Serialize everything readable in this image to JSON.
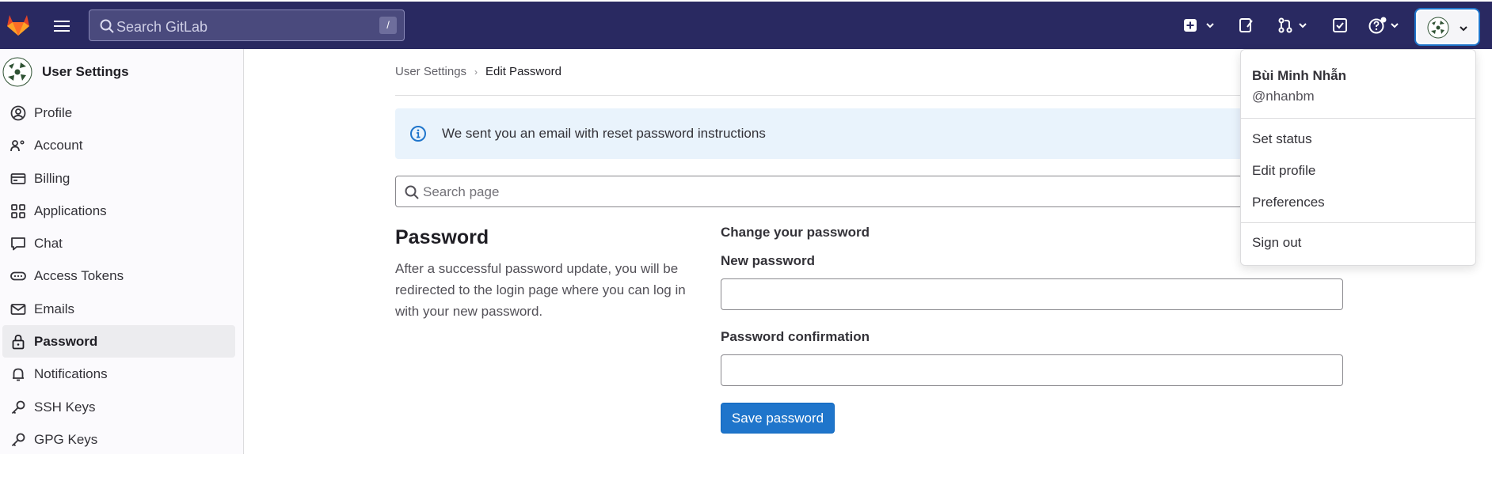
{
  "topbar": {
    "search_placeholder": "Search GitLab",
    "search_shortcut": "/",
    "icons": [
      "gitlab-logo",
      "hamburger-menu",
      "plus-square",
      "issues",
      "merge-request",
      "todo-check",
      "help",
      "user-avatar"
    ]
  },
  "sidebar": {
    "title": "User Settings",
    "items": [
      {
        "label": "Profile",
        "icon": "profile"
      },
      {
        "label": "Account",
        "icon": "account"
      },
      {
        "label": "Billing",
        "icon": "billing"
      },
      {
        "label": "Applications",
        "icon": "applications"
      },
      {
        "label": "Chat",
        "icon": "chat"
      },
      {
        "label": "Access Tokens",
        "icon": "token"
      },
      {
        "label": "Emails",
        "icon": "mail"
      },
      {
        "label": "Password",
        "icon": "lock",
        "active": true
      },
      {
        "label": "Notifications",
        "icon": "bell"
      },
      {
        "label": "SSH Keys",
        "icon": "key"
      },
      {
        "label": "GPG Keys",
        "icon": "key"
      }
    ]
  },
  "breadcrumb": {
    "parent": "User Settings",
    "separator": "›",
    "current": "Edit Password"
  },
  "alert": {
    "text": "We sent you an email with reset password instructions"
  },
  "page_search": {
    "placeholder": "Search page"
  },
  "section": {
    "title": "Password",
    "description": "After a successful password update, you will be redirected to the login page where you can log in with your new password."
  },
  "form": {
    "heading": "Change your password",
    "new_password_label": "New password",
    "new_password_value": "",
    "confirm_label": "Password confirmation",
    "confirm_value": "",
    "save_label": "Save password"
  },
  "user_menu": {
    "name": "Bùi Minh Nhẫn",
    "username": "@nhanbm",
    "items": [
      "Set status",
      "Edit profile",
      "Preferences"
    ],
    "sign_out": "Sign out"
  },
  "colors": {
    "topbar": "#292961",
    "primary": "#1f75cb",
    "alert_bg": "#e9f3fc",
    "active_item": "#ececef"
  }
}
